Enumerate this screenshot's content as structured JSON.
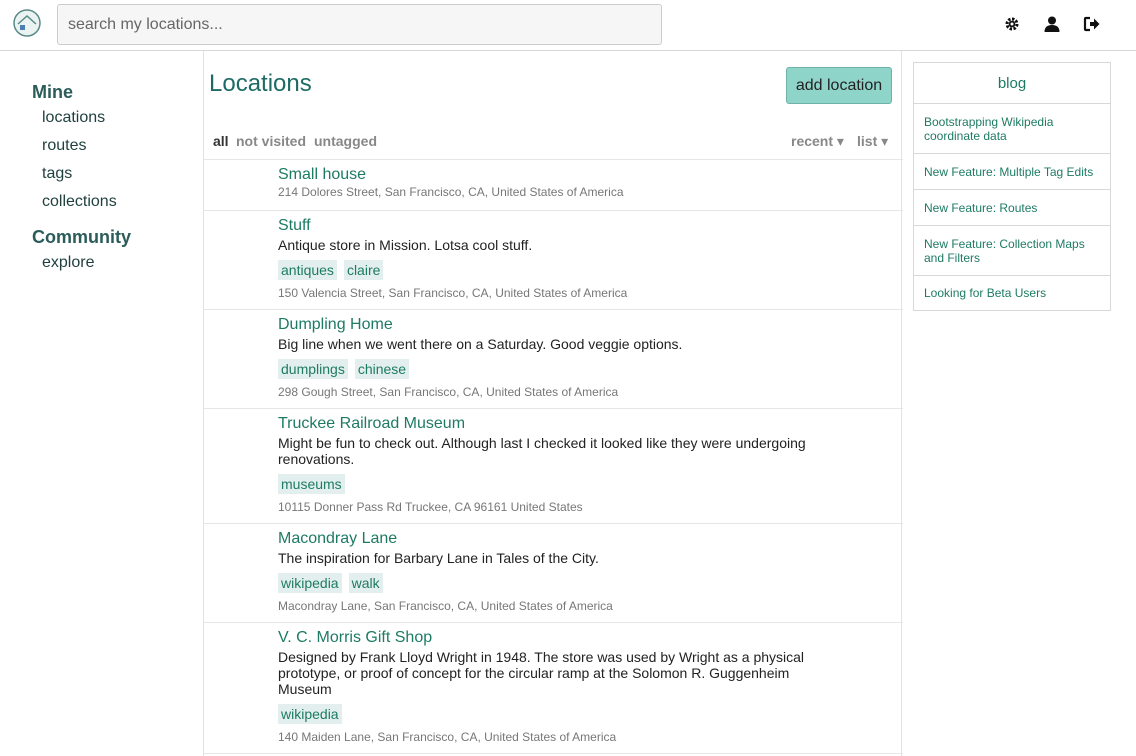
{
  "header": {
    "search_placeholder": "search my locations...",
    "icons": [
      "logo-icon",
      "gear-icon",
      "user-icon",
      "logout-icon"
    ]
  },
  "sidebar": {
    "sections": [
      {
        "heading": "Mine",
        "items": [
          "locations",
          "routes",
          "tags",
          "collections"
        ]
      },
      {
        "heading": "Community",
        "items": [
          "explore"
        ]
      }
    ]
  },
  "main": {
    "title": "Locations",
    "add_button": "add location",
    "filters": [
      "all",
      "not visited",
      "untagged"
    ],
    "sort": "recent ▾",
    "view": "list ▾",
    "locations": [
      {
        "name": "Small house",
        "description": "",
        "tags": [],
        "address": "214 Dolores Street, San Francisco, CA, United States of America"
      },
      {
        "name": "Stuff",
        "description": "Antique store in Mission. Lotsa cool stuff.",
        "tags": [
          "antiques",
          "claire"
        ],
        "address": "150 Valencia Street, San Francisco, CA, United States of America"
      },
      {
        "name": "Dumpling Home",
        "description": "Big line when we went there on a Saturday. Good veggie options.",
        "tags": [
          "dumplings",
          "chinese"
        ],
        "address": "298 Gough Street, San Francisco, CA, United States of America"
      },
      {
        "name": "Truckee Railroad Museum",
        "description": "Might be fun to check out. Although last I checked it looked like they were undergoing renovations.",
        "tags": [
          "museums"
        ],
        "address": "10115 Donner Pass Rd Truckee, CA 96161 United States"
      },
      {
        "name": "Macondray Lane",
        "description": "The inspiration for Barbary Lane in Tales of the City.",
        "tags": [
          "wikipedia",
          "walk"
        ],
        "address": "Macondray Lane, San Francisco, CA, United States of America"
      },
      {
        "name": "V. C. Morris Gift Shop",
        "description": "Designed by Frank Lloyd Wright in 1948. The store was used by Wright as a physical prototype, or proof of concept for the circular ramp at the Solomon R. Guggenheim Museum",
        "tags": [
          "wikipedia"
        ],
        "address": "140 Maiden Lane, San Francisco, CA, United States of America"
      }
    ]
  },
  "blog": {
    "heading": "blog",
    "items": [
      "Bootstrapping Wikipedia coordinate data",
      "New Feature: Multiple Tag Edits",
      "New Feature: Routes",
      "New Feature: Collection Maps and Filters",
      "Looking for Beta Users"
    ]
  },
  "colors": {
    "accent": "#1e7b63",
    "button": "#8fd4c8",
    "tag_bg": "#e3efee"
  }
}
